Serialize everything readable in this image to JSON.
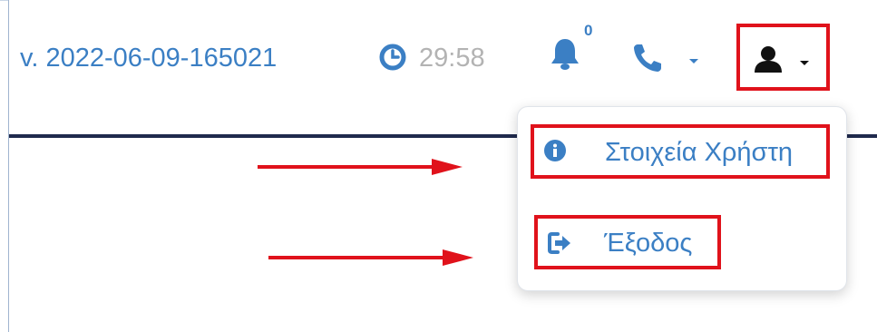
{
  "header": {
    "version": "v. 2022-06-09-165021",
    "timer": "29:58",
    "notifications_count": "0"
  },
  "icons": {
    "clock": "clock-icon",
    "bell": "bell-icon",
    "phone": "phone-icon",
    "user": "user-icon",
    "info": "info-circle-icon",
    "logout": "sign-out-icon"
  },
  "user_menu": {
    "items": [
      {
        "label": "Στοιχεία Χρήστη"
      },
      {
        "label": "Έξοδος"
      }
    ]
  },
  "colors": {
    "accent": "#3b7fc4",
    "highlight": "#e0121b",
    "header_rule": "#1f2a4d",
    "muted": "#b3b3b3"
  }
}
